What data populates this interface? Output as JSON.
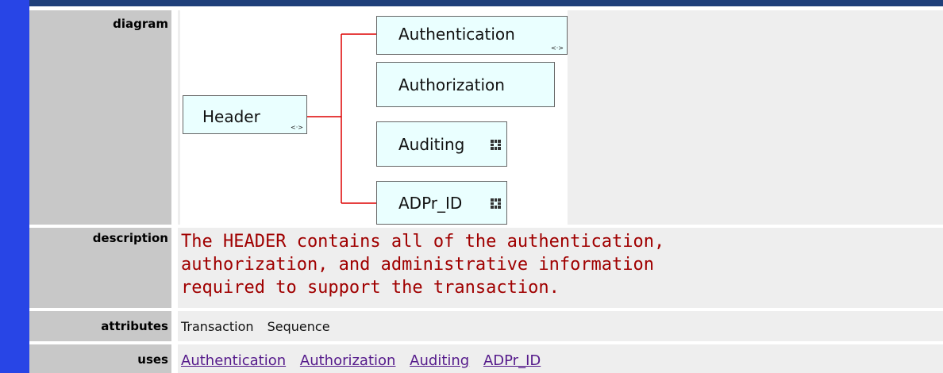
{
  "rows": {
    "diagram_label": "diagram",
    "description_label": "description",
    "attributes_label": "attributes",
    "uses_label": "uses"
  },
  "diagram": {
    "root": "Header",
    "children": [
      "Authentication",
      "Authorization",
      "Auditing",
      "ADPr_ID"
    ],
    "ref_marker": "<·>"
  },
  "description_lines": [
    "The HEADER contains all of the authentication,",
    "authorization, and administrative information",
    "required to support the transaction."
  ],
  "attributes": [
    "Transaction",
    "Sequence"
  ],
  "uses": [
    "Authentication",
    "Authorization",
    "Auditing",
    "ADPr_ID"
  ],
  "colors": {
    "connector": "#dd0000",
    "description_text": "#a00000",
    "link": "#551a8b"
  }
}
